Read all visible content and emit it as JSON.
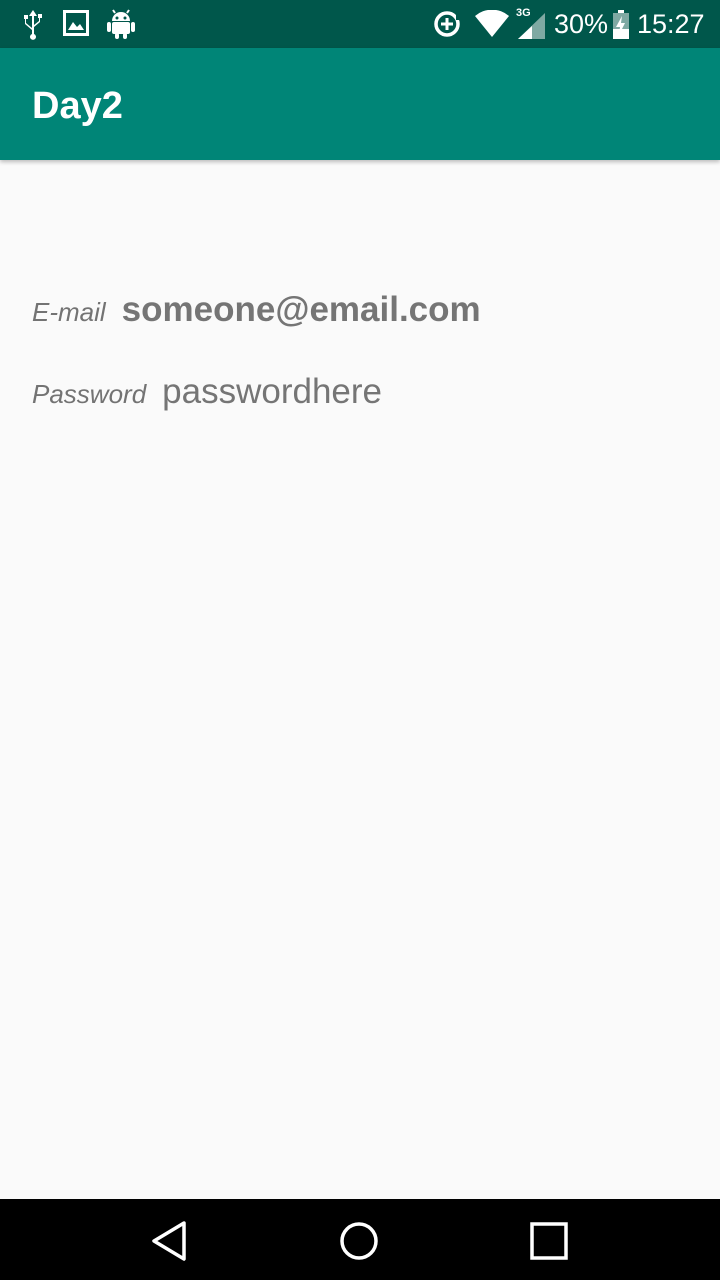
{
  "status_bar": {
    "battery_percent": "30%",
    "time": "15:27",
    "network_type": "3G",
    "icons": [
      "usb-icon",
      "image-icon",
      "android-icon",
      "data-saver-icon",
      "wifi-icon",
      "signal-icon",
      "battery-charging-icon"
    ]
  },
  "app_bar": {
    "title": "Day2",
    "color": "#008577",
    "status_color": "#00574b"
  },
  "form": {
    "email_label": "E-mail",
    "email_value": "someone@email.com",
    "password_label": "Password",
    "password_value": "passwordhere"
  },
  "nav_bar": {
    "buttons": [
      "back-icon",
      "home-icon",
      "recents-icon"
    ]
  }
}
